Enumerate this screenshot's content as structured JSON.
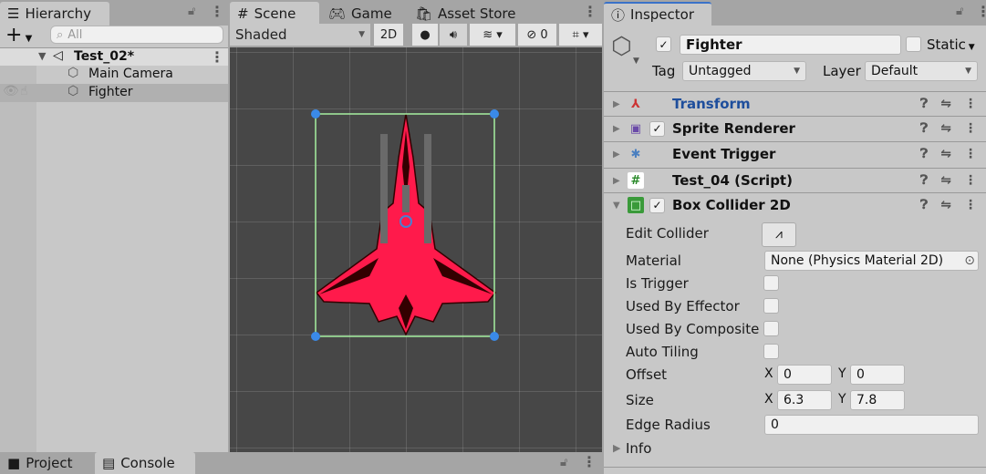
{
  "hierarchy": {
    "tab": "Hierarchy",
    "search_placeholder": "All",
    "add": "+",
    "scene": "Test_02*",
    "items": [
      "Main Camera",
      "Fighter"
    ]
  },
  "scene_view": {
    "tabs": [
      "Scene",
      "Game",
      "Asset Store"
    ],
    "shading": "Shaded",
    "mode_2d": "2D",
    "hidden_count": "0"
  },
  "bottom": {
    "tabs": [
      "Project",
      "Console"
    ]
  },
  "inspector": {
    "tab": "Inspector",
    "name": "Fighter",
    "static_label": "Static",
    "tag_label": "Tag",
    "tag": "Untagged",
    "layer_label": "Layer",
    "layer": "Default",
    "components": [
      "Transform",
      "Sprite Renderer",
      "Event Trigger",
      "Test_04 (Script)",
      "Box Collider 2D"
    ],
    "props": {
      "edit_collider": "Edit Collider",
      "material": "Material",
      "material_value": "None (Physics Material 2D)",
      "is_trigger": "Is Trigger",
      "used_by_effector": "Used By Effector",
      "used_by_composite": "Used By Composite",
      "auto_tiling": "Auto Tiling",
      "offset": "Offset",
      "offset_x": "0",
      "offset_y": "0",
      "size": "Size",
      "size_x": "6.3",
      "size_y": "7.8",
      "edge_radius": "Edge Radius",
      "edge_radius_value": "0",
      "info": "Info",
      "x": "X",
      "y": "Y"
    }
  },
  "colors": {
    "accent": "#3a72c8",
    "ship": "#ff1a4b",
    "collider": "#a6f0a0"
  }
}
